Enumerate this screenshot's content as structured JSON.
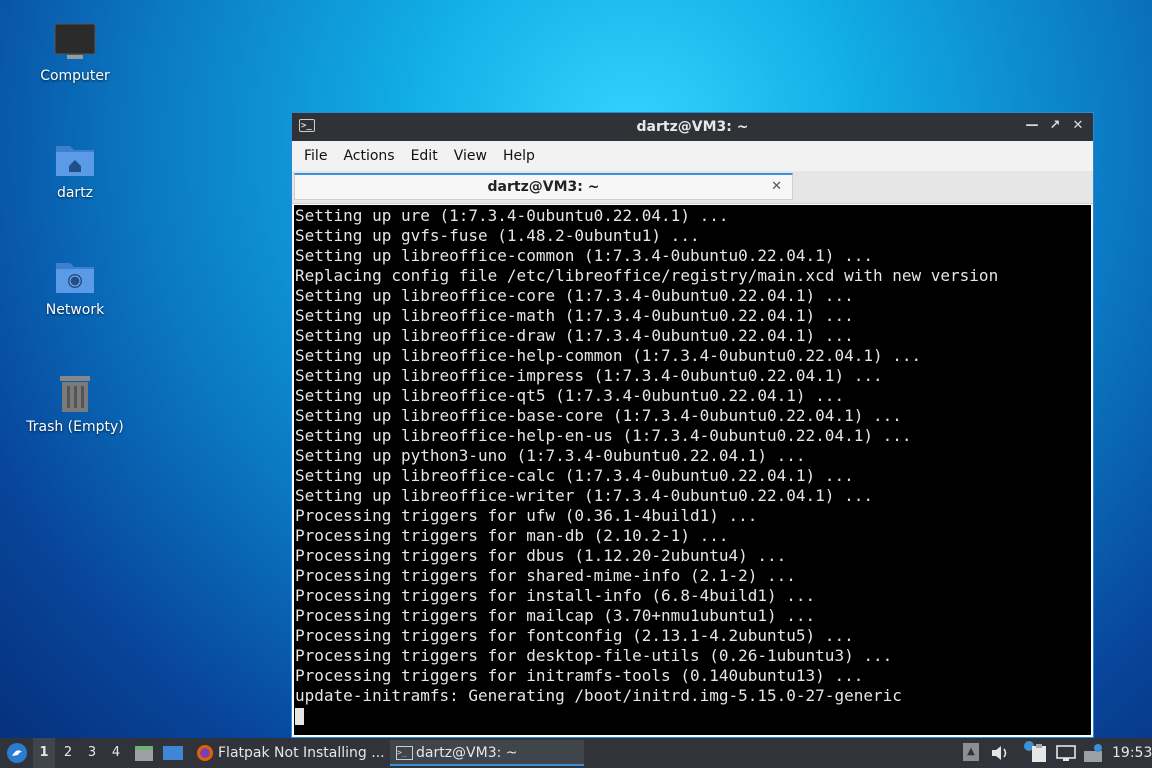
{
  "desktop": {
    "icons": [
      {
        "label": "Computer"
      },
      {
        "label": "dartz"
      },
      {
        "label": "Network"
      },
      {
        "label": "Trash (Empty)"
      }
    ]
  },
  "window": {
    "title": "dartz@VM3: ~",
    "menu": [
      "File",
      "Actions",
      "Edit",
      "View",
      "Help"
    ],
    "tab_label": "dartz@VM3: ~",
    "terminal_lines": [
      "Setting up ure (1:7.3.4-0ubuntu0.22.04.1) ...",
      "Setting up gvfs-fuse (1.48.2-0ubuntu1) ...",
      "Setting up libreoffice-common (1:7.3.4-0ubuntu0.22.04.1) ...",
      "Replacing config file /etc/libreoffice/registry/main.xcd with new version",
      "Setting up libreoffice-core (1:7.3.4-0ubuntu0.22.04.1) ...",
      "Setting up libreoffice-math (1:7.3.4-0ubuntu0.22.04.1) ...",
      "Setting up libreoffice-draw (1:7.3.4-0ubuntu0.22.04.1) ...",
      "Setting up libreoffice-help-common (1:7.3.4-0ubuntu0.22.04.1) ...",
      "Setting up libreoffice-impress (1:7.3.4-0ubuntu0.22.04.1) ...",
      "Setting up libreoffice-qt5 (1:7.3.4-0ubuntu0.22.04.1) ...",
      "Setting up libreoffice-base-core (1:7.3.4-0ubuntu0.22.04.1) ...",
      "Setting up libreoffice-help-en-us (1:7.3.4-0ubuntu0.22.04.1) ...",
      "Setting up python3-uno (1:7.3.4-0ubuntu0.22.04.1) ...",
      "Setting up libreoffice-calc (1:7.3.4-0ubuntu0.22.04.1) ...",
      "Setting up libreoffice-writer (1:7.3.4-0ubuntu0.22.04.1) ...",
      "Processing triggers for ufw (0.36.1-4build1) ...",
      "Processing triggers for man-db (2.10.2-1) ...",
      "Processing triggers for dbus (1.12.20-2ubuntu4) ...",
      "Processing triggers for shared-mime-info (2.1-2) ...",
      "Processing triggers for install-info (6.8-4build1) ...",
      "Processing triggers for mailcap (3.70+nmu1ubuntu1) ...",
      "Processing triggers for fontconfig (2.13.1-4.2ubuntu5) ...",
      "Processing triggers for desktop-file-utils (0.26-1ubuntu3) ...",
      "Processing triggers for initramfs-tools (0.140ubuntu13) ...",
      "update-initramfs: Generating /boot/initrd.img-5.15.0-27-generic"
    ]
  },
  "taskbar": {
    "workspaces": [
      "1",
      "2",
      "3",
      "4"
    ],
    "tasks": [
      {
        "label": "Flatpak Not Installing ...",
        "icon": "firefox-icon"
      },
      {
        "label": "dartz@VM3: ~",
        "icon": "terminal-icon"
      }
    ],
    "clock": "19:53"
  },
  "colors": {
    "accent": "#3d8fd6",
    "terminal_bg": "#000000",
    "titlebar_bg": "#2f3338"
  }
}
